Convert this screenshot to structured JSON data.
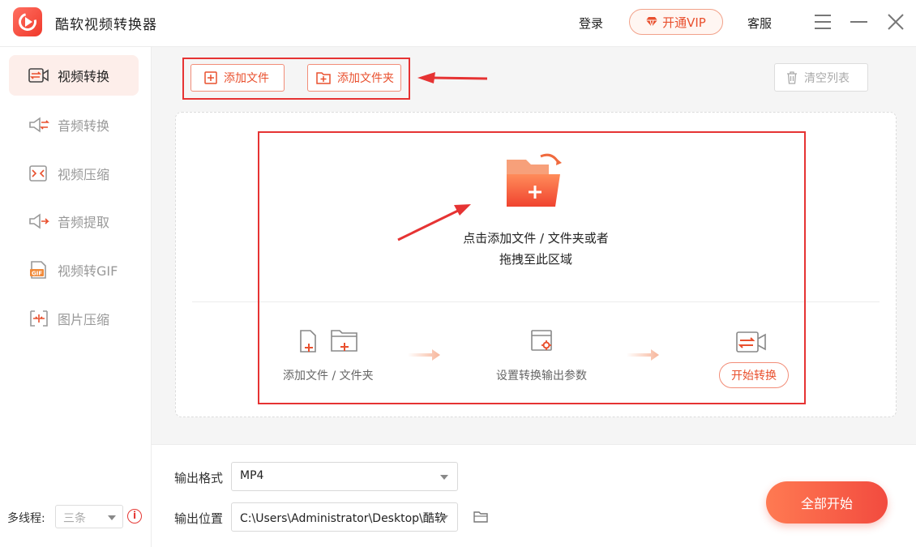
{
  "app": {
    "title": "酷软视频转换器"
  },
  "header": {
    "login": "登录",
    "vip": "开通VIP",
    "service": "客服"
  },
  "sidebar": {
    "items": [
      {
        "label": "视频转换",
        "icon": "video-convert-icon",
        "active": true
      },
      {
        "label": "音频转换",
        "icon": "audio-convert-icon",
        "active": false
      },
      {
        "label": "视频压缩",
        "icon": "video-compress-icon",
        "active": false
      },
      {
        "label": "音频提取",
        "icon": "audio-extract-icon",
        "active": false
      },
      {
        "label": "视频转GIF",
        "icon": "gif-icon",
        "active": false
      },
      {
        "label": "图片压缩",
        "icon": "image-compress-icon",
        "active": false
      }
    ],
    "threads_label": "多线程:",
    "threads_value": "三条"
  },
  "toolbar": {
    "add_file": "添加文件",
    "add_folder": "添加文件夹",
    "clear_list": "清空列表"
  },
  "dropzone": {
    "line1": "点击添加文件 / 文件夹或者",
    "line2": "拖拽至此区域",
    "step1": "添加文件 / 文件夹",
    "step2": "设置转换输出参数",
    "step3_button": "开始转换"
  },
  "output": {
    "format_label": "输出格式",
    "format_value": "MP4",
    "location_label": "输出位置",
    "location_value": "C:\\Users\\Administrator\\Desktop\\酷软"
  },
  "actions": {
    "start_all": "全部开始"
  },
  "colors": {
    "accent": "#f24b3f",
    "highlight": "#e63333"
  }
}
